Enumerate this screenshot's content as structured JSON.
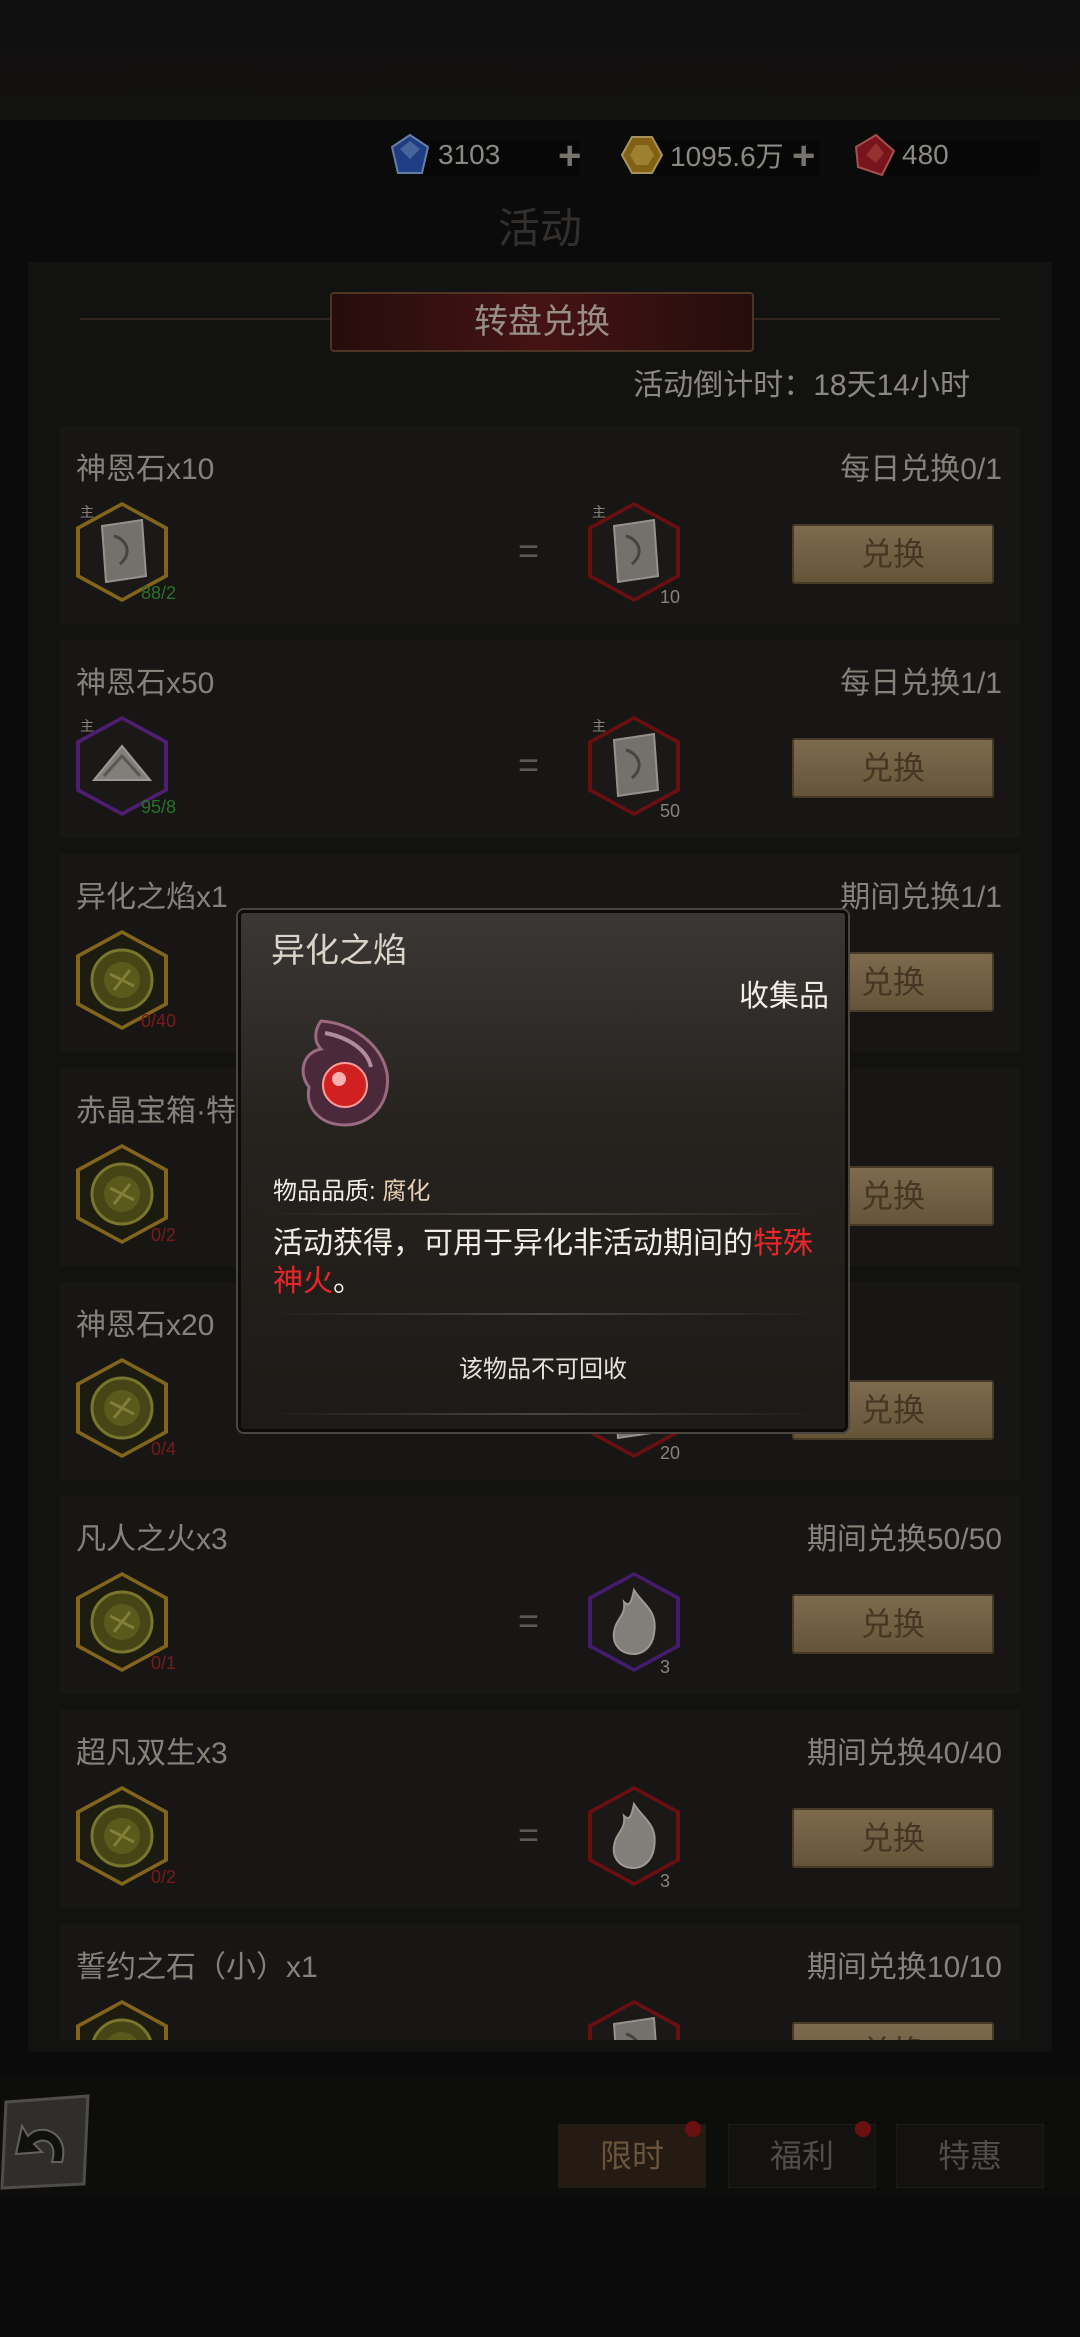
{
  "currencies": [
    {
      "icon": "blue-gem-icon",
      "value": "3103",
      "color": "#3d6fd6"
    },
    {
      "icon": "gold-gem-icon",
      "value": "1095.6万",
      "color": "#d6a62a"
    },
    {
      "icon": "red-gem-icon",
      "value": "480",
      "color": "#c8262b"
    }
  ],
  "page_title": "活动",
  "banner": "转盘兑换",
  "countdown": "活动倒计时：18天14小时",
  "exchange_label": "兑换",
  "rows": [
    {
      "title": "神恩石x10",
      "limit": "每日兑换0/1",
      "cost_progress": "88/2",
      "cost_progress_color": "#3fae3f",
      "cost_tag": "主",
      "reward_tag": "主",
      "reward_qty": "10",
      "cost_frame": "#c89a2a",
      "reward_frame": "#a3171a"
    },
    {
      "title": "神恩石x50",
      "limit": "每日兑换1/1",
      "cost_progress": "95/8",
      "cost_progress_color": "#3fae3f",
      "cost_tag": "主",
      "reward_tag": "主",
      "reward_qty": "50",
      "cost_frame": "#7a2fb0",
      "reward_frame": "#a3171a"
    },
    {
      "title": "异化之焰x1",
      "limit": "期间兑换1/1",
      "cost_progress": "0/40",
      "cost_progress_color": "#b52a2a",
      "cost_tag": "",
      "reward_tag": "",
      "reward_qty": "",
      "cost_frame": "#c89a2a",
      "reward_frame": "#a3171a"
    },
    {
      "title": "赤晶宝箱·特",
      "limit": "",
      "cost_progress": "0/2",
      "cost_progress_color": "#b52a2a",
      "cost_tag": "",
      "reward_tag": "",
      "reward_qty": "",
      "cost_frame": "#c89a2a",
      "reward_frame": "#a3171a"
    },
    {
      "title": "神恩石x20",
      "limit": "",
      "cost_progress": "0/4",
      "cost_progress_color": "#b52a2a",
      "cost_tag": "",
      "reward_tag": "",
      "reward_qty": "20",
      "cost_frame": "#c89a2a",
      "reward_frame": "#a3171a"
    },
    {
      "title": "凡人之火x3",
      "limit": "期间兑换50/50",
      "cost_progress": "0/1",
      "cost_progress_color": "#b52a2a",
      "cost_tag": "",
      "reward_tag": "",
      "reward_qty": "3",
      "cost_frame": "#c89a2a",
      "reward_frame": "#6a2ba8"
    },
    {
      "title": "超凡双生x3",
      "limit": "期间兑换40/40",
      "cost_progress": "0/2",
      "cost_progress_color": "#b52a2a",
      "cost_tag": "",
      "reward_tag": "",
      "reward_qty": "3",
      "cost_frame": "#c89a2a",
      "reward_frame": "#a3171a"
    },
    {
      "title": "誓约之石（小）x1",
      "limit": "期间兑换10/10",
      "cost_progress": "",
      "cost_progress_color": "#b52a2a",
      "cost_tag": "",
      "reward_tag": "",
      "reward_qty": "",
      "cost_frame": "#c89a2a",
      "reward_frame": "#a3171a"
    }
  ],
  "popup": {
    "title": "异化之焰",
    "category": "收集品",
    "quality_label": "物品品质:",
    "quality_value": "腐化",
    "desc_plain": "活动获得，可用于异化非活动期间的",
    "desc_red": "特殊神火",
    "desc_end": "。",
    "no_recycle": "该物品不可回收"
  },
  "tabs": [
    {
      "label": "限时",
      "active": true,
      "dot": true
    },
    {
      "label": "福利",
      "active": false,
      "dot": true
    },
    {
      "label": "特惠",
      "active": false,
      "dot": false
    }
  ]
}
